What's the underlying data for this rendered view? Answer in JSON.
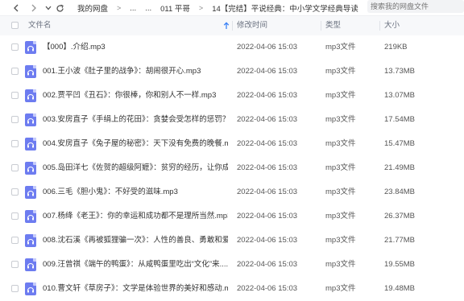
{
  "toolbar": {
    "back_icon": "chevron-left-icon",
    "forward_icon": "chevron-right-icon",
    "dropdown_icon": "chevron-down-icon",
    "refresh_icon": "refresh-icon",
    "breadcrumb": [
      "我的网盘",
      "...",
      "011 平哥",
      "14【完结】平说经典：中小学文学经典导读"
    ],
    "ellipsis_sep": "...",
    "search_placeholder": "搜索我的网盘文件"
  },
  "table": {
    "columns": {
      "name": "文件名",
      "modified": "修改时间",
      "type": "类型",
      "size": "大小"
    },
    "sort_icon": "arrow-up-icon",
    "accent_color": "#6d7cf0",
    "rows": [
      {
        "name": "【000】.介绍.mp3",
        "modified": "2022-04-06 15:03",
        "type": "mp3文件",
        "size": "219KB"
      },
      {
        "name": "001.王小波《肚子里的战争》：胡闹很开心.mp3",
        "modified": "2022-04-06 15:03",
        "type": "mp3文件",
        "size": "13.73MB"
      },
      {
        "name": "002.贾平凹《丑石》：你很棒，你和别人不一样.mp3",
        "modified": "2022-04-06 15:03",
        "type": "mp3文件",
        "size": "13.07MB"
      },
      {
        "name": "003.安房直子《手绢上的花田》：贪婪会受怎样的惩罚？....",
        "modified": "2022-04-06 15:03",
        "type": "mp3文件",
        "size": "17.54MB"
      },
      {
        "name": "004.安房直子《兔子屋的秘密》：天下没有免费的晚餐.mp3",
        "modified": "2022-04-06 15:03",
        "type": "mp3文件",
        "size": "15.47MB"
      },
      {
        "name": "005.岛田洋七《佐贺的超级阿嬷》：贫穷的经历，让你成...",
        "modified": "2022-04-06 15:03",
        "type": "mp3文件",
        "size": "21.49MB"
      },
      {
        "name": "006.三毛《胆小鬼》：不好受的滋味.mp3",
        "modified": "2022-04-06 15:03",
        "type": "mp3文件",
        "size": "23.84MB"
      },
      {
        "name": "007.杨绛《老王》：你的幸运和成功都不是理所当然.mp3",
        "modified": "2022-04-06 15:03",
        "type": "mp3文件",
        "size": "26.37MB"
      },
      {
        "name": "008.沈石溪《再被狐狸骗一次》：人性的善良、勇敢和爱...",
        "modified": "2022-04-06 15:03",
        "type": "mp3文件",
        "size": "21.77MB"
      },
      {
        "name": "009.汪曾祺《端午的鸭蛋》：从咸鸭蛋里吃出“文化”来....",
        "modified": "2022-04-06 15:03",
        "type": "mp3文件",
        "size": "19.55MB"
      },
      {
        "name": "010.曹文轩《草房子》：文学是体验世界的美好和感动.m...",
        "modified": "2022-04-06 15:03",
        "type": "mp3文件",
        "size": "19.48MB"
      }
    ]
  }
}
